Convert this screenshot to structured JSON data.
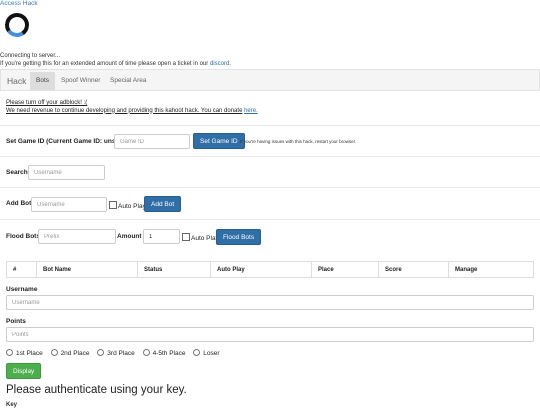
{
  "header": {
    "access_link": "Access Hack",
    "connecting": "Connecting to server...",
    "extended_msg": "If you're getting this for an extended amount of time please open a ticket in our",
    "discord_link": "discord",
    "period": "."
  },
  "colors": {
    "primary": "#2f6ea6",
    "success": "#4cae4c",
    "link": "#2a6db0"
  },
  "nav": {
    "brand": "Hack",
    "tabs": [
      "Bots",
      "Spoof Winner",
      "Special Area"
    ],
    "active_tab": "Bots"
  },
  "adblock": {
    "line1": "Please turn off your adblock! :(",
    "line2": "We need revenue to continue developing and providing this kahoot hack. You can donate",
    "donate_link": "here."
  },
  "game_id": {
    "label": "Set Game ID (Current Game ID: unset)",
    "placeholder": "Game ID",
    "button": "Set Game ID",
    "note": "If you're having issues with this hack, restart your browser."
  },
  "search": {
    "label": "Search",
    "placeholder": "Username"
  },
  "add_bot": {
    "label": "Add Bot",
    "placeholder": "Username",
    "auto_play": "Auto Play",
    "button": "Add Bot"
  },
  "flood": {
    "label": "Flood Bots",
    "prefix_placeholder": "Prefix",
    "amount_label": "Amount",
    "amount_value": "1",
    "auto_play": "Auto Play",
    "button": "Flood Bots"
  },
  "table": {
    "columns": [
      "#",
      "Bot Name",
      "Status",
      "Auto Play",
      "Place",
      "Score",
      "Manage"
    ]
  },
  "spoof": {
    "username_label": "Username",
    "username_placeholder": "Username",
    "points_label": "Points",
    "points_placeholder": "Points",
    "places": [
      "1st Place",
      "2nd Place",
      "3rd Place",
      "4-5th Place",
      "Loser"
    ],
    "display_button": "Display"
  },
  "auth": {
    "title": "Please authenticate using your key.",
    "key_label": "Key"
  }
}
